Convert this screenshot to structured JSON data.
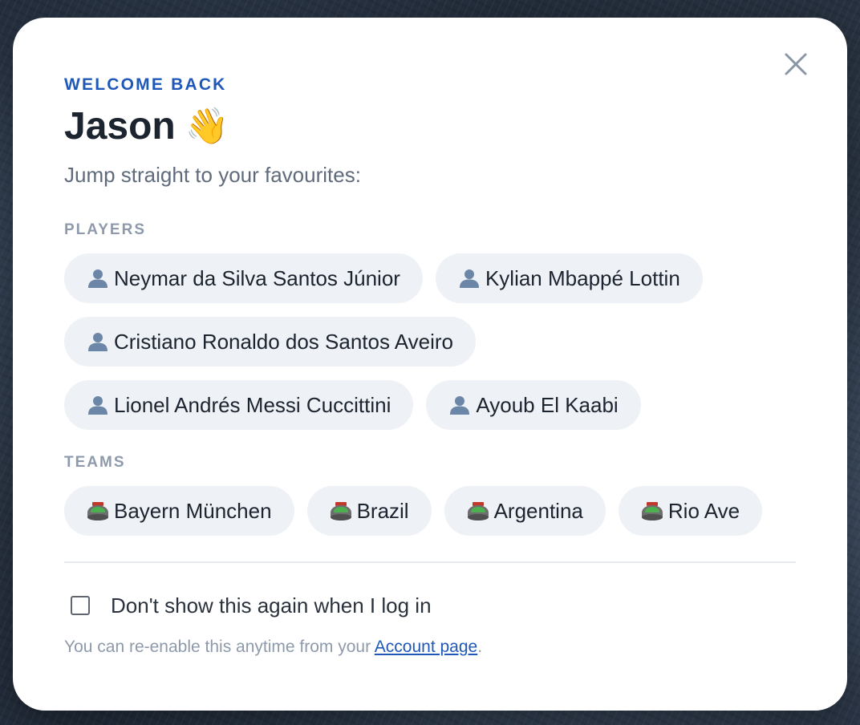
{
  "modal": {
    "eyebrow": "WELCOME BACK",
    "user_name": "Jason",
    "wave_emoji": "👋",
    "subtitle": "Jump straight to your favourites:",
    "close_icon": "close-icon"
  },
  "players": {
    "label": "PLAYERS",
    "icon": "person-icon",
    "items": [
      {
        "name": "Neymar da Silva Santos Júnior"
      },
      {
        "name": "Kylian Mbappé Lottin"
      },
      {
        "name": "Cristiano Ronaldo dos Santos Aveiro"
      },
      {
        "name": "Lionel Andrés Messi Cuccittini"
      },
      {
        "name": "Ayoub El Kaabi"
      }
    ]
  },
  "teams": {
    "label": "TEAMS",
    "icon": "stadium-icon",
    "items": [
      {
        "name": "Bayern München"
      },
      {
        "name": "Brazil"
      },
      {
        "name": "Argentina"
      },
      {
        "name": "Rio Ave"
      }
    ]
  },
  "preferences": {
    "dont_show_label": "Don't show this again when I log in",
    "dont_show_checked": false,
    "footnote_prefix": "You can re-enable this anytime from your ",
    "footnote_link": "Account page",
    "footnote_suffix": "."
  },
  "colors": {
    "accent": "#1f58b8",
    "chip_bg": "#eef1f5",
    "muted": "#8e9aab"
  }
}
